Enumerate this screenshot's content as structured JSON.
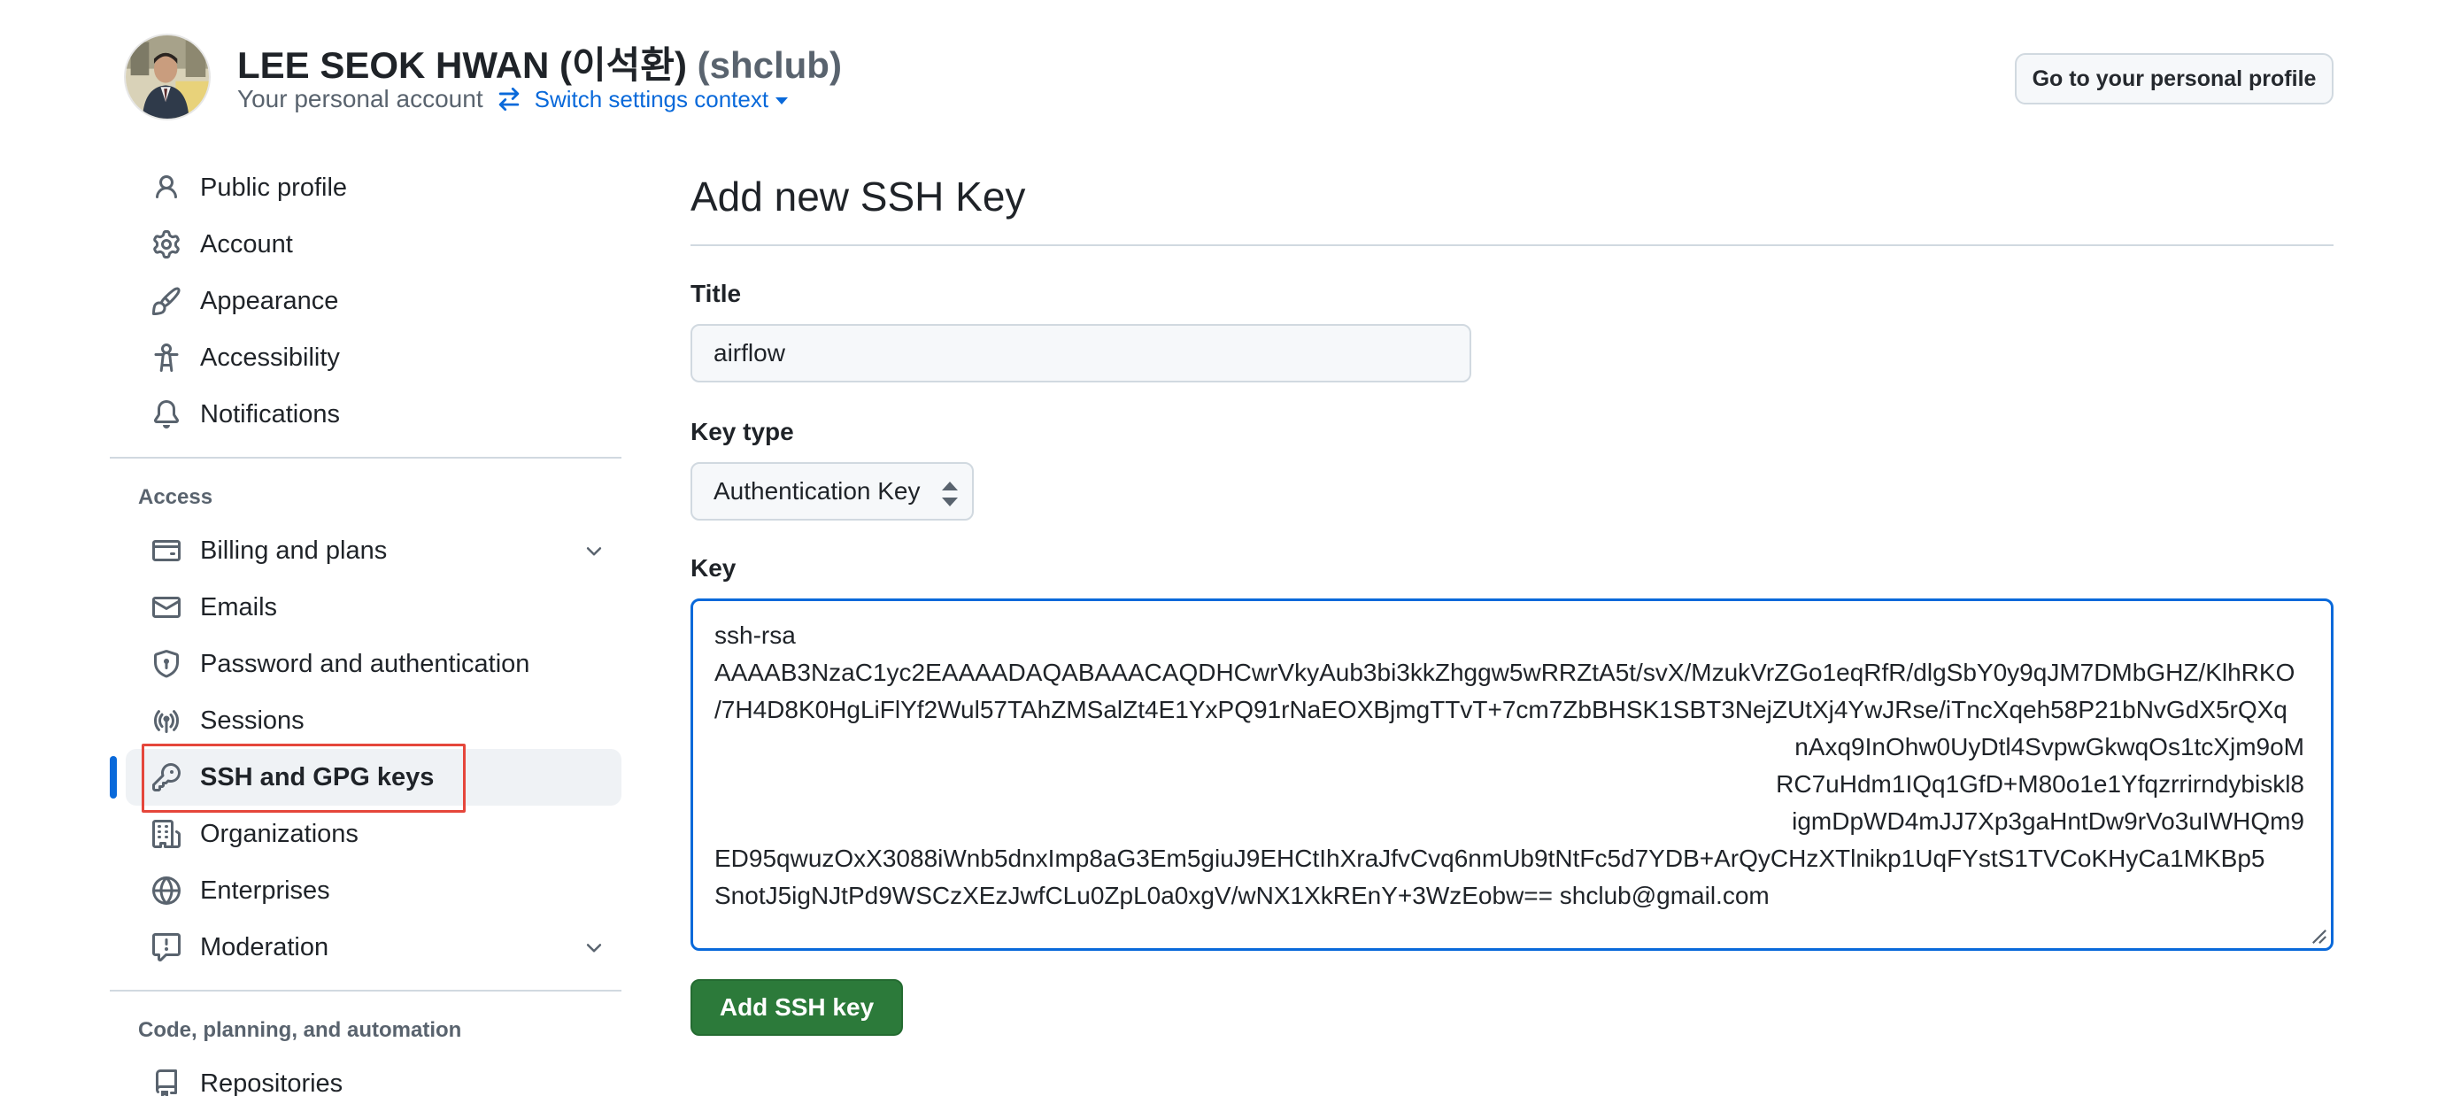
{
  "header": {
    "display_name": "LEE SEOK HWAN (이석환)",
    "login": "(shclub)",
    "account_type": "Your personal account",
    "switch_context": "Switch settings context",
    "profile_button": "Go to your personal profile"
  },
  "sidebar": {
    "items": [
      {
        "label": "Public profile",
        "icon": "person-icon"
      },
      {
        "label": "Account",
        "icon": "gear-icon"
      },
      {
        "label": "Appearance",
        "icon": "paintbrush-icon"
      },
      {
        "label": "Accessibility",
        "icon": "accessibility-icon"
      },
      {
        "label": "Notifications",
        "icon": "bell-icon"
      }
    ],
    "access_title": "Access",
    "access_items": [
      {
        "label": "Billing and plans",
        "icon": "credit-card-icon",
        "expandable": true
      },
      {
        "label": "Emails",
        "icon": "mail-icon"
      },
      {
        "label": "Password and authentication",
        "icon": "shield-lock-icon"
      },
      {
        "label": "Sessions",
        "icon": "broadcast-icon"
      },
      {
        "label": "SSH and GPG keys",
        "icon": "key-icon",
        "active": true
      },
      {
        "label": "Organizations",
        "icon": "organization-icon"
      },
      {
        "label": "Enterprises",
        "icon": "globe-icon"
      },
      {
        "label": "Moderation",
        "icon": "report-icon",
        "expandable": true
      }
    ],
    "code_title": "Code, planning, and automation",
    "code_items": [
      {
        "label": "Repositories",
        "icon": "repo-icon"
      }
    ]
  },
  "main": {
    "page_title": "Add new SSH Key",
    "title_label": "Title",
    "title_value": "airflow",
    "key_type_label": "Key type",
    "key_type_value": "Authentication Key",
    "key_label": "Key",
    "key_lines": [
      "ssh-rsa",
      "AAAAB3NzaC1yc2EAAAADAQABAAACAQDHCwrVkyAub3bi3kkZhggw5wRRZtA5t/svX/MzukVrZGo1eqRfR/dlgSbY0y9qJM7DMbGHZ/KlhRKO",
      "/7H4D8K0HgLiFlYf2Wul57TAhZMSalZt4E1YxPQ91rNaEOXBjmgTTvT+7cm7ZbBHSK1SBT3NejZUtXj4YwJRse/iTncXqeh58P21bNvGdX5rQXq",
      "nAxq9InOhw0UyDtl4SvpwGkwqOs1tcXjm9oM",
      "RC7uHdm1IQq1GfD+M80o1e1Yfqzrrirndybiskl8",
      "igmDpWD4mJJ7Xp3gaHntDw9rVo3uIWHQm9",
      "ED95qwuzOxX3088iWnb5dnxImp8aG3Em5giuJ9EHCtIhXraJfvCvq6nmUb9tNtFc5d7YDB+ArQyCHzXTlnikp1UqFYstS1TVCoKHyCa1MKBp5",
      "SnotJ5igNJtPd9WSCzXEzJwfCLu0ZpL0a0xgV/wNX1XkREnY+3WzEobw== shclub@gmail.com"
    ],
    "submit_label": "Add SSH key"
  },
  "colors": {
    "accent": "#0969da",
    "primary_button": "#2c7a3a",
    "highlight": "#e5463b"
  }
}
